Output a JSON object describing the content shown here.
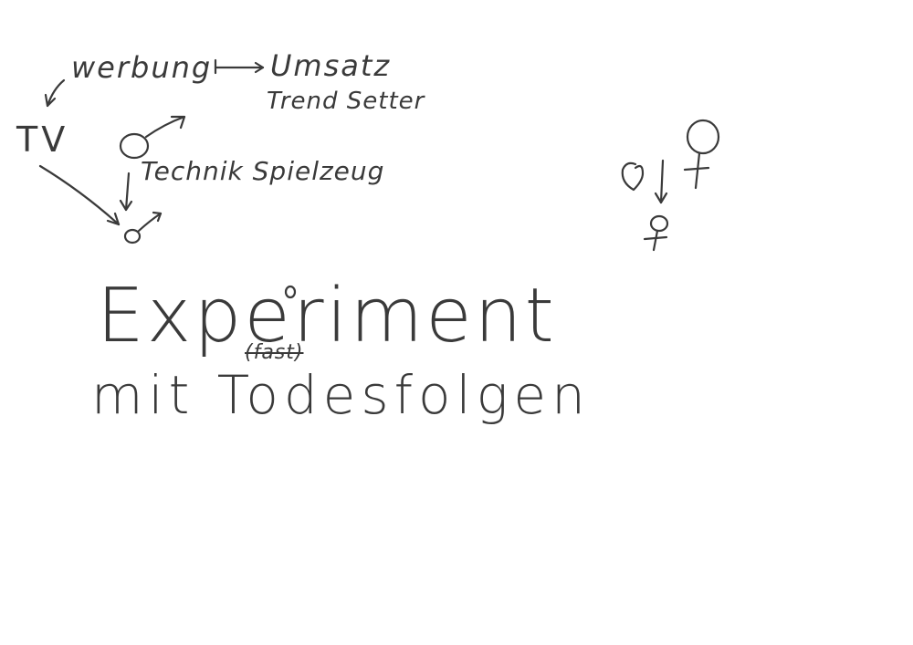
{
  "sketch": {
    "werbung": "werbung",
    "umsatz": "Umsatz",
    "trend_setter": "Trend Setter",
    "tv": "TV",
    "technik_spielzeug": "Technik Spielzeug",
    "experiment": "Experiment",
    "fast": "(fast)",
    "mit_todesfolgen": "mit Todesfolgen"
  },
  "colors": {
    "background": "#ffffff",
    "ink": "#3a3a3a"
  },
  "icons": {
    "male_symbols": [
      "male-symbol-icon",
      "male-symbol-small-icon"
    ],
    "female_symbols": [
      "female-symbol-icon",
      "female-symbol-small-icon"
    ],
    "heart": "heart-icon"
  }
}
